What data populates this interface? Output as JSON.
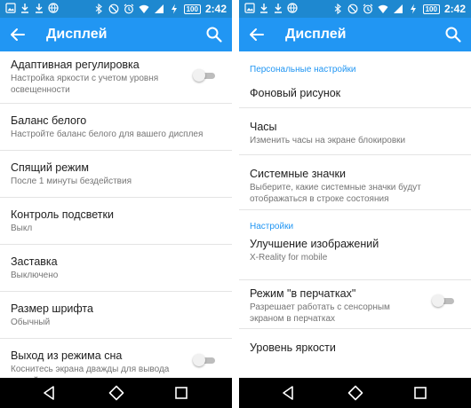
{
  "status_bar": {
    "time": "2:42",
    "battery": "100"
  },
  "left_screen": {
    "title": "Дисплей",
    "items": [
      {
        "title": "Адаптивная регулировка",
        "subtitle": "Настройка яркости с учетом уровня освещенности"
      },
      {
        "title": "Баланс белого",
        "subtitle": "Настройте баланс белого для вашего дисплея"
      },
      {
        "title": "Спящий режим",
        "subtitle": "После 1 минуты бездействия"
      },
      {
        "title": "Контроль подсветки",
        "subtitle": "Выкл"
      },
      {
        "title": "Заставка",
        "subtitle": "Выключено"
      },
      {
        "title": "Размер шрифта",
        "subtitle": "Обычный"
      },
      {
        "title": "Выход из режима сна",
        "subtitle": "Коснитесь экрана дважды для вывода устройства из режима сна"
      }
    ]
  },
  "right_screen": {
    "title": "Дисплей",
    "sections": [
      {
        "header": "Персональные настройки",
        "items": [
          {
            "title": "Фоновый рисунок"
          },
          {
            "title": "Часы",
            "subtitle": "Изменить часы на экране блокировки"
          },
          {
            "title": "Системные значки",
            "subtitle": "Выберите, какие системные значки будут отображаться в строке состояния"
          }
        ]
      },
      {
        "header": "Настройки",
        "items": [
          {
            "title": "Улучшение изображений",
            "subtitle": "X-Reality for mobile"
          },
          {
            "title": "Режим \"в перчатках\"",
            "subtitle": "Разрешает работать с сенсорным экраном в перчатках"
          },
          {
            "title": "Уровень яркости"
          }
        ]
      }
    ]
  },
  "icons": {
    "status_left": [
      "image-icon",
      "download-icon",
      "download-icon",
      "globe-icon"
    ],
    "status_right": [
      "bluetooth-icon",
      "do-not-disturb-icon",
      "alarm-icon",
      "wifi-icon",
      "signal-icon",
      "charging-icon",
      "battery-icon"
    ],
    "app_bar": [
      "back-arrow-icon",
      "search-icon"
    ],
    "nav": [
      "nav-back-icon",
      "nav-home-icon",
      "nav-recents-icon"
    ]
  },
  "colors": {
    "status_bar": "#1e88d0",
    "app_bar": "#2196f3",
    "accent": "#2196f3",
    "toggle_off": "#bdbdbd"
  },
  "toggles": {
    "adaptive_brightness": false,
    "wake_on_double_tap": false,
    "glove_mode": false
  }
}
